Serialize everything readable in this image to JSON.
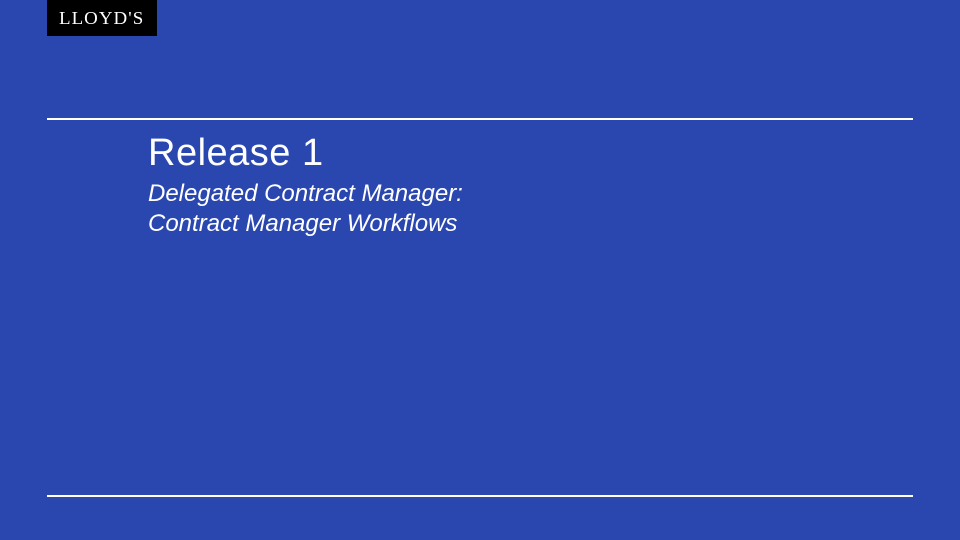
{
  "brand": {
    "name": "LLOYD'S"
  },
  "slide": {
    "title": "Release 1",
    "subtitle": "Delegated Contract Manager:\nContract Manager Workflows"
  },
  "colors": {
    "background": "#2a47b0",
    "logo_bg": "#000000",
    "text": "#ffffff"
  }
}
